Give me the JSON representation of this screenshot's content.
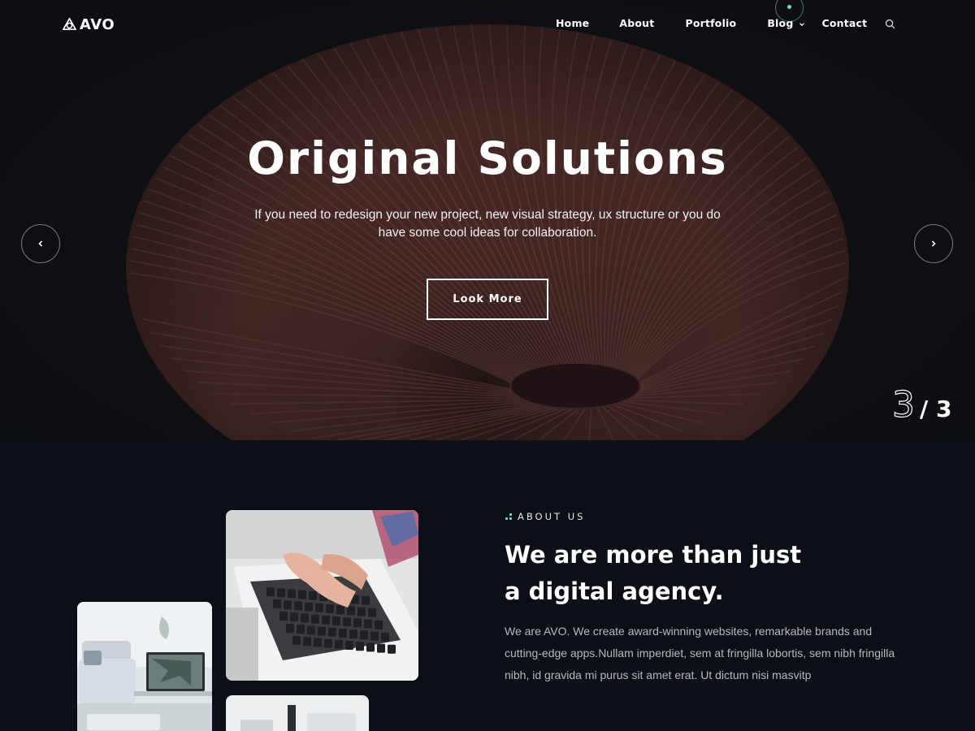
{
  "brand": {
    "name": "AVO",
    "logo_icon": "triangle-knot-logo"
  },
  "nav": {
    "items": [
      {
        "label": "Home"
      },
      {
        "label": "About"
      },
      {
        "label": "Portfolio"
      },
      {
        "label": "Blog",
        "has_dropdown": true
      },
      {
        "label": "Contact"
      }
    ],
    "search_icon": "search-icon",
    "accent": "#6fe0c0"
  },
  "hero": {
    "title": "Original Solutions",
    "subtitle": "If you need to redesign your new project, new visual strategy, ux structure or you do have some cool ideas for collaboration.",
    "button_label": "Look More",
    "prev_icon": "chevron-left-icon",
    "next_icon": "chevron-right-icon",
    "slide_current": "3",
    "slide_total": "/ 3",
    "background_tint": "#4a2a27"
  },
  "about": {
    "eyebrow": "ABOUT US",
    "title_line1": "We are more than just",
    "title_line2": "a digital agency.",
    "body": "We are AVO. We create award-winning websites, remarkable brands and cutting-edge apps.Nullam imperdiet, sem at fringilla lobortis, sem nibh fringilla nibh, id gravida mi purus sit amet erat. Ut dictum nisi masvitp"
  }
}
